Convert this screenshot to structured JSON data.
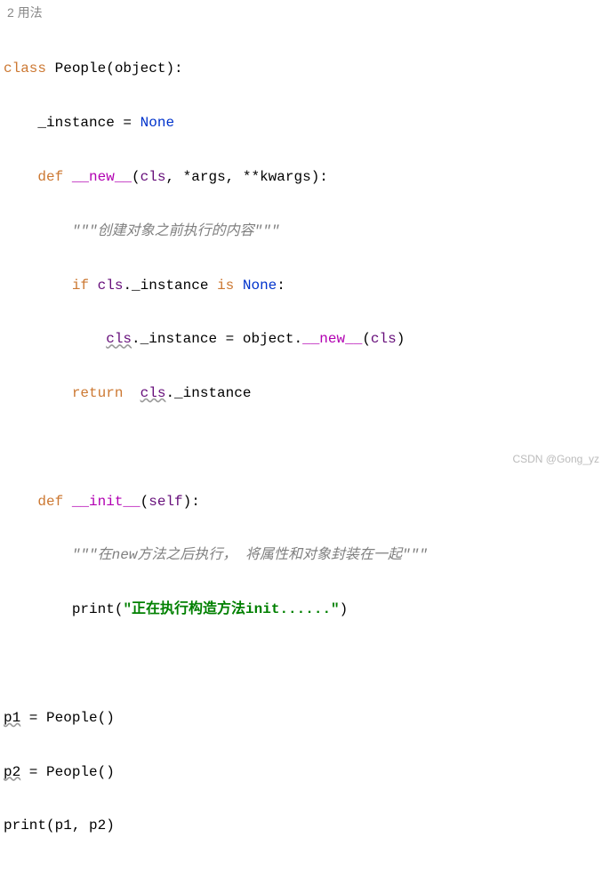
{
  "header": "2 用法",
  "code": {
    "line1": {
      "class_kw": "class ",
      "name": "People",
      "paren_open": "(",
      "obj": "object",
      "paren_close": "):"
    },
    "line2": {
      "indent": "    ",
      "var": "_instance",
      "eq": " = ",
      "none": "None"
    },
    "line3": {
      "indent": "    ",
      "def_kw": "def ",
      "fn": "__new__",
      "params_open": "(",
      "cls": "cls",
      "comma1": ", *",
      "args": "args",
      "comma2": ", **",
      "kwargs": "kwargs",
      "close": "):"
    },
    "line4": {
      "indent": "        ",
      "docstring": "\"\"\"创建对象之前执行的内容\"\"\""
    },
    "line5": {
      "indent": "        ",
      "if_kw": "if ",
      "cls": "cls",
      "dot": ".",
      "inst": "_instance",
      "is_kw": " is ",
      "none": "None",
      "colon": ":"
    },
    "line6": {
      "indent": "            ",
      "cls": "cls",
      "dot1": ".",
      "inst": "_instance",
      "eq": " = ",
      "obj": "object",
      "dot2": ".",
      "new": "__new__",
      "open": "(",
      "cls2": "cls",
      "close": ")"
    },
    "line7": {
      "indent": "        ",
      "ret": "return",
      "space": "  ",
      "cls": "cls",
      "dot": ".",
      "inst": "_instance"
    },
    "line8": "",
    "line9": {
      "indent": "    ",
      "def_kw": "def ",
      "fn": "__init__",
      "open": "(",
      "self": "self",
      "close": "):"
    },
    "line10": {
      "indent": "        ",
      "docstring": "\"\"\"在new方法之后执行， 将属性和对象封装在一起\"\"\""
    },
    "line11": {
      "indent": "        ",
      "print": "print",
      "open": "(",
      "str": "\"正在执行构造方法init......\"",
      "close": ")"
    },
    "line12": "",
    "line13": {
      "var": "p1",
      "eq": " = People()"
    },
    "line14": {
      "var": "p2",
      "eq": " = People()"
    },
    "line15": {
      "print": "print",
      "open": "(",
      "p1": "p1",
      "comma": ", ",
      "p2": "p2",
      "close": ")"
    }
  },
  "watermark": "CSDN @Gong_yz"
}
